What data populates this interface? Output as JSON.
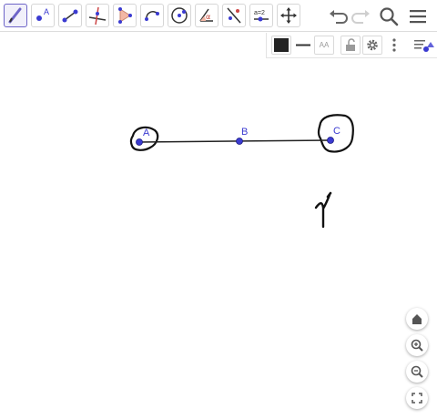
{
  "toolbar": {
    "tools": [
      {
        "name": "freehand-pen-tool",
        "icon": "pen-icon",
        "active": true
      },
      {
        "name": "point-tool",
        "icon": "point-icon",
        "label": "A"
      },
      {
        "name": "segment-tool",
        "icon": "segment-icon"
      },
      {
        "name": "perpendicular-line-tool",
        "icon": "perpendicular-icon"
      },
      {
        "name": "polygon-tool",
        "icon": "polygon-icon"
      },
      {
        "name": "semicircle-tool",
        "icon": "arc-icon"
      },
      {
        "name": "circle-tool",
        "icon": "circle-icon"
      },
      {
        "name": "angle-tool",
        "icon": "angle-icon",
        "label": "α"
      },
      {
        "name": "reflect-tool",
        "icon": "reflect-icon"
      },
      {
        "name": "slider-tool",
        "icon": "slider-icon",
        "label": "a=2"
      },
      {
        "name": "move-graphics-tool",
        "icon": "move-icon"
      }
    ],
    "right": [
      "undo-icon",
      "redo-icon",
      "search-icon",
      "menu-icon"
    ]
  },
  "stylebar": {
    "color": "#222222",
    "text_size_label": "AA",
    "icons": [
      "color-swatch-icon",
      "line-style-icon",
      "text-size-icon",
      "lock-icon",
      "settings-icon",
      "more-vert-icon",
      "algebra-toggle-icon"
    ]
  },
  "canvas": {
    "points": [
      {
        "label": "A"
      },
      {
        "label": "B"
      },
      {
        "label": "C"
      }
    ],
    "point_color": "#3b3bd1"
  },
  "zoom_controls": [
    "home-icon",
    "zoom-in-icon",
    "zoom-out-icon",
    "fullscreen-icon"
  ]
}
